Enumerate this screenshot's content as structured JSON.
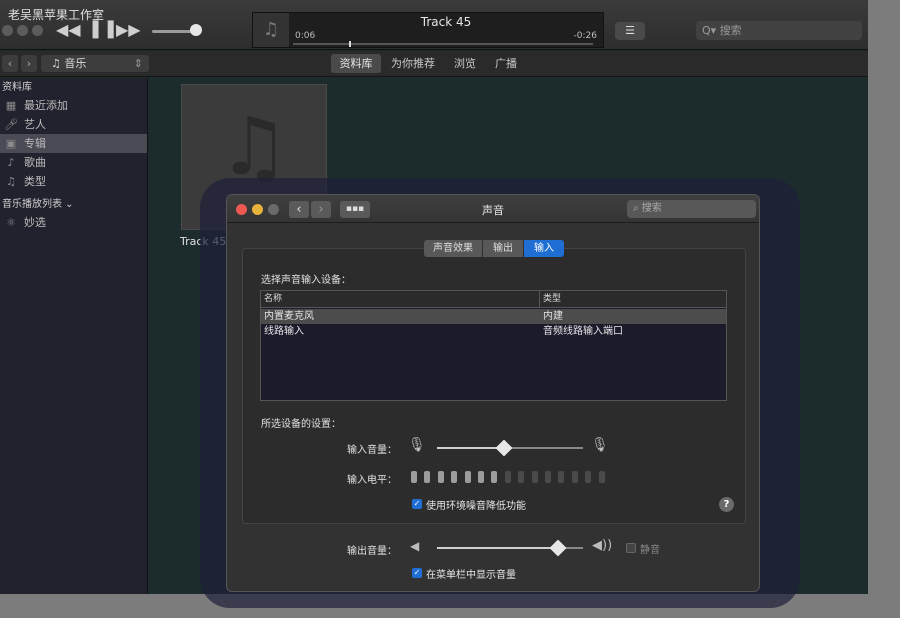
{
  "watermark": "老吴黑苹果工作室",
  "player": {
    "track_title": "Track 45",
    "elapsed": "0:06",
    "remaining": "-0:26",
    "search_placeholder": "搜索",
    "media_kind": "音乐",
    "segments": [
      "资料库",
      "为你推荐",
      "浏览",
      "广播"
    ],
    "active_segment": "资料库"
  },
  "sidebar": {
    "library_header": "资料库",
    "items": [
      {
        "label": "最近添加",
        "icon": "grid-icon"
      },
      {
        "label": "艺人",
        "icon": "microphone-icon"
      },
      {
        "label": "专辑",
        "icon": "album-icon"
      },
      {
        "label": "歌曲",
        "icon": "note-icon"
      },
      {
        "label": "类型",
        "icon": "genre-icon"
      }
    ],
    "selected": "专辑",
    "playlists_header": "音乐播放列表",
    "playlists": [
      {
        "label": "妙选",
        "icon": "genius-icon"
      }
    ]
  },
  "album": {
    "title": "Track 45"
  },
  "sound": {
    "title": "声音",
    "search_placeholder": "搜索",
    "tabs": [
      "声音效果",
      "输出",
      "输入"
    ],
    "active_tab": "输入",
    "choose_label": "选择声音输入设备：",
    "columns": [
      "名称",
      "类型"
    ],
    "devices": [
      {
        "name": "内置麦克风",
        "type": "内建",
        "selected": true
      },
      {
        "name": "线路输入",
        "type": "音频线路输入端口",
        "selected": false
      }
    ],
    "settings_label": "所选设备的设置：",
    "input_volume_label": "输入音量：",
    "input_volume": 0.46,
    "input_level_label": "输入电平：",
    "input_level_segments": 15,
    "input_level_lit": 7,
    "noise_reduction_label": "使用环境噪音降低功能",
    "noise_reduction": true,
    "help": "?",
    "output_volume_label": "输出音量：",
    "output_volume": 0.83,
    "mute_label": "静音",
    "mute": false,
    "show_in_menubar_label": "在菜单栏中显示音量",
    "show_in_menubar": true
  },
  "colors": {
    "accent": "#1f6ed4",
    "window_bg": "#323232"
  }
}
